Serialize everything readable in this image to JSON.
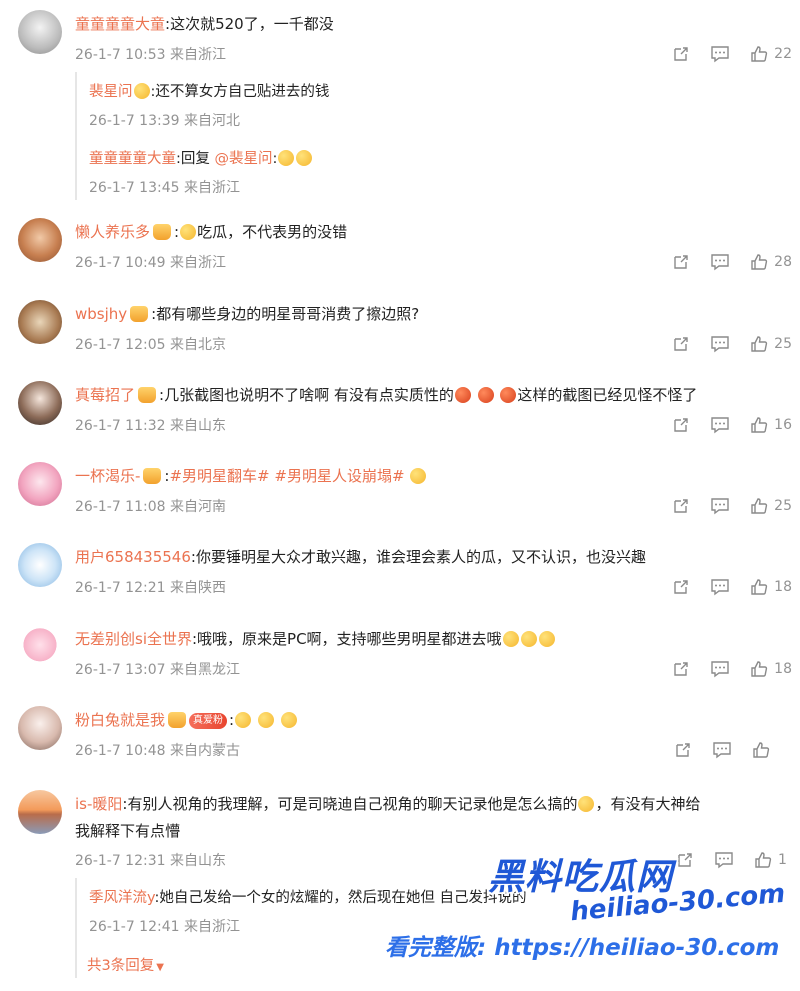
{
  "comments": [
    {
      "user": "童童童童大童",
      "text": ":这次就520了，一千都没",
      "meta": "26-1-7 10:53 来自浙江",
      "likes": "22",
      "replies": [
        {
          "user": "裴星问",
          "text": ":还不算女方自己贴进去的钱",
          "meta": "26-1-7 13:39 来自河北"
        },
        {
          "user": "童童童童大童",
          "text_prefix": ":回复",
          "mention": "@裴星问",
          "text": ":",
          "meta": "26-1-7 13:45 来自浙江"
        }
      ]
    },
    {
      "user": "懒人养乐多",
      "text": "吃瓜，不代表男的没错",
      "meta": "26-1-7 10:49 来自浙江",
      "likes": "28"
    },
    {
      "user": "wbsjhy",
      "text": ":都有哪些身边的明星哥哥消费了擦边照?",
      "meta": "26-1-7 12:05 来自北京",
      "likes": "25"
    },
    {
      "user": "真莓招了",
      "text": ":几张截图也说明不了啥啊 有没有点实质性的",
      "text2": "这样的截图已经见怪不怪了",
      "meta": "26-1-7 11:32 来自山东",
      "likes": "16"
    },
    {
      "user": "一杯渴乐-",
      "text": ":",
      "tag1": "#男明星翻车#",
      "tag2": "#男明星人设崩塌#",
      "meta": "26-1-7 11:08 来自河南",
      "likes": "25"
    },
    {
      "user": "用户658435546",
      "text": ":你要锤明星大众才敢兴趣，谁会理会素人的瓜，又不认识，也没兴趣",
      "meta": "26-1-7 12:21 来自陕西",
      "likes": "18"
    },
    {
      "user": "无差别创si全世界",
      "text": ":哦哦，原来是PC啊，支持哪些男明星都进去哦",
      "meta": "26-1-7 13:07 来自黑龙江",
      "likes": "18"
    },
    {
      "user": "粉白兔就是我",
      "fan_badge": "真爱粉",
      "text": ":",
      "meta": "26-1-7 10:48 来自内蒙古",
      "likes": ""
    },
    {
      "user": "is-暖阳",
      "text": ":有别人视角的我理解，可是司晓迪自己视角的聊天记录他是怎么搞的",
      "text_b": "，有没有大神给",
      "text2": "我解释下有点懵",
      "meta": "26-1-7 12:31 来自山东",
      "likes": "1",
      "replies": [
        {
          "user": "季风洋流y",
          "text": ":她自己发给一个女的炫耀的，然后现在她但",
          "text_c": "自己发抖说的",
          "meta": "26-1-7 12:41 来自浙江"
        }
      ],
      "more_replies": "共3条回复"
    }
  ],
  "watermark": {
    "title": "黑料吃瓜网",
    "line": "看完整版: https://heiliao-30.com",
    "url_big": "heiliao-30.com"
  },
  "colors": {
    "username": "#eb7350",
    "meta": "#939393",
    "watermark": "#1f58d6"
  },
  "icons": [
    "share-icon",
    "comment-icon",
    "like-icon",
    "chevron-down-icon"
  ]
}
